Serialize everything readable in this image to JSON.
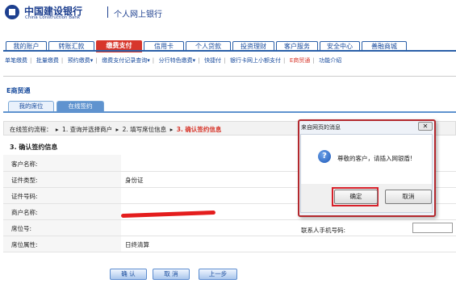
{
  "header": {
    "bank_name": "中国建设银行",
    "bank_name_en": "China Construction Bank",
    "portal_title": "个人网上银行"
  },
  "main_tabs": [
    {
      "label": "我的账户"
    },
    {
      "label": "转账汇款"
    },
    {
      "label": "缴费支付",
      "active": true
    },
    {
      "label": "信用卡"
    },
    {
      "label": "个人贷款"
    },
    {
      "label": "投资理财"
    },
    {
      "label": "客户服务"
    },
    {
      "label": "安全中心"
    },
    {
      "label": "善融商城"
    }
  ],
  "sub_nav": [
    {
      "label": "单笔缴费"
    },
    {
      "label": "批量缴费"
    },
    {
      "label": "预约缴费▾"
    },
    {
      "label": "缴费支付记录查询▾"
    },
    {
      "label": "分行特色缴费▾"
    },
    {
      "label": "快捷付"
    },
    {
      "label": "银行卡网上小额支付"
    },
    {
      "label": "E商贸通",
      "active": true
    },
    {
      "label": "功能介绍"
    }
  ],
  "section_title": "E商贸通",
  "page_tabs": [
    {
      "label": "我的席位"
    },
    {
      "label": "在线签约",
      "active": true
    }
  ],
  "flow": {
    "prefix": "在线签约流程：",
    "steps": [
      "1. 查询并选择商户",
      "2. 填写席位信息",
      "3. 确认签约信息"
    ]
  },
  "form_title": "3. 确认签约信息",
  "form_rows": [
    {
      "label": "客户名称:",
      "value": ""
    },
    {
      "label": "证件类型:",
      "value": "身份证"
    },
    {
      "label": "证件号码:",
      "value": ""
    },
    {
      "label": "商户名称:",
      "value": ""
    },
    {
      "label": "席位号:",
      "value": ""
    },
    {
      "label": "席位属性:",
      "value": "日终清算"
    }
  ],
  "phone_label": "联系人手机号码:",
  "buttons": {
    "confirm": "确 认",
    "cancel": "取 消",
    "prev": "上一步"
  },
  "dialog": {
    "title": "来自网页的消息",
    "close": "✕",
    "icon": "question-icon",
    "message": "尊敬的客户，请插入网银盾!",
    "ok": "确定",
    "cancel": "取消"
  },
  "colors": {
    "brand_blue": "#1d3f8f",
    "accent_red": "#d7362b",
    "link_blue": "#174a9c"
  }
}
